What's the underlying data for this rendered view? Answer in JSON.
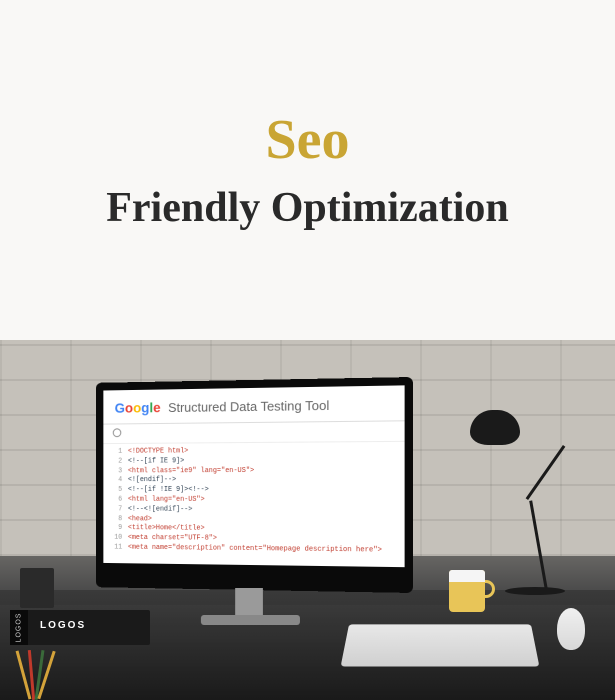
{
  "header": {
    "title_line1": "Seo",
    "title_line2": "Friendly Optimization"
  },
  "screen": {
    "brand": {
      "g1": "G",
      "o1": "o",
      "o2": "o",
      "g2": "g",
      "l": "l",
      "e": "e"
    },
    "tool_title": "Structured Data Testing Tool",
    "code": [
      "<!DOCTYPE html>",
      "<!--[if IE 9]>",
      "<html class=\"ie9\" lang=\"en-US\">",
      "<![endif]-->",
      "<!--[if !IE 9]><!-->",
      "<html lang=\"en-US\">",
      "<!--<![endif]-->",
      "<head>",
      "<title>Home</title>",
      "<meta charset=\"UTF-8\">",
      "<meta name=\"description\" content=\"Homepage description here\">"
    ]
  },
  "desk_items": {
    "book_spine": "LOGOS",
    "book_label": "LOGOS"
  }
}
